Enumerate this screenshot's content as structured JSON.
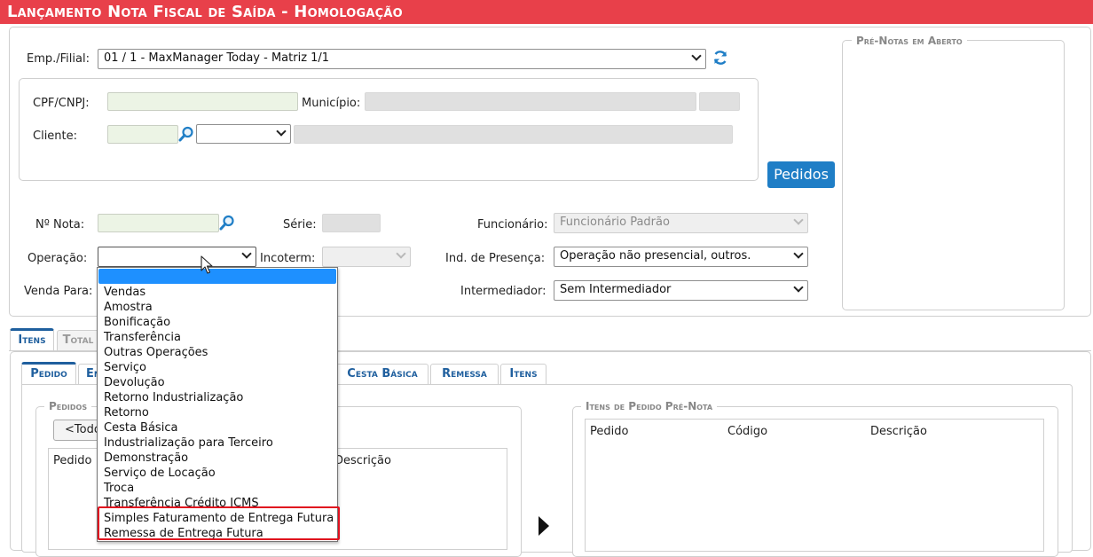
{
  "title": "Lançamento Nota Fiscal de Saída  - Homologação",
  "header": {
    "emp_label": "Emp./Filial:",
    "emp_value": "01 / 1 - MaxManager Today - Matriz 1/1",
    "pedidos_button": "Pedidos"
  },
  "client": {
    "cpf_label": "CPF/CNPJ:",
    "municipio_label": "Município:",
    "cliente_label": "Cliente:"
  },
  "form": {
    "nota_label": "Nº Nota:",
    "serie_label": "Série:",
    "funcionario_label": "Funcionário:",
    "funcionario_value": "Funcionário Padrão",
    "operacao_label": "Operação:",
    "incoterm_label": "Incoterm:",
    "presenca_label": "Ind. de Presença:",
    "presenca_value": "Operação não presencial, outros.",
    "venda_para_label": "Venda Para:",
    "intermediador_label": "Intermediador:",
    "intermediador_value": "Sem Intermediador"
  },
  "pre_notas": {
    "legend": "Pré-Notas em Aberto"
  },
  "main_tabs": [
    "Itens",
    "Total"
  ],
  "sub_tabs": {
    "pedido": "Pedido",
    "partial": "En",
    "cesta": "Cesta Básica",
    "remessa": "Remessa",
    "itens": "Itens"
  },
  "pedidos_panel": {
    "legend": "Pedidos",
    "todos_button": "<Todo",
    "col_pedido": "Pedido",
    "col_descricao": "Descrição"
  },
  "itens_panel": {
    "legend": "Itens de Pedido Pré-Nota",
    "col_pedido": "Pedido",
    "col_codigo": "Código",
    "col_descricao": "Descrição"
  },
  "operacao_options": [
    "Vendas",
    "Amostra",
    "Bonificação",
    "Transferência",
    "Outras Operações",
    "Serviço",
    "Devolução",
    "Retorno Industrialização",
    "Retorno",
    "Cesta Básica",
    "Industrialização para Terceiro",
    "Demonstração",
    "Serviço de Locação",
    "Troca",
    "Transferência Crédito ICMS",
    "Simples Faturamento de Entrega Futura",
    "Remessa de Entrega Futura"
  ],
  "colors": {
    "title_bar": "#e8404a",
    "accent_blue": "#1f7ec6",
    "highlight": "#e0101e",
    "selected_option": "#1e90ff"
  }
}
